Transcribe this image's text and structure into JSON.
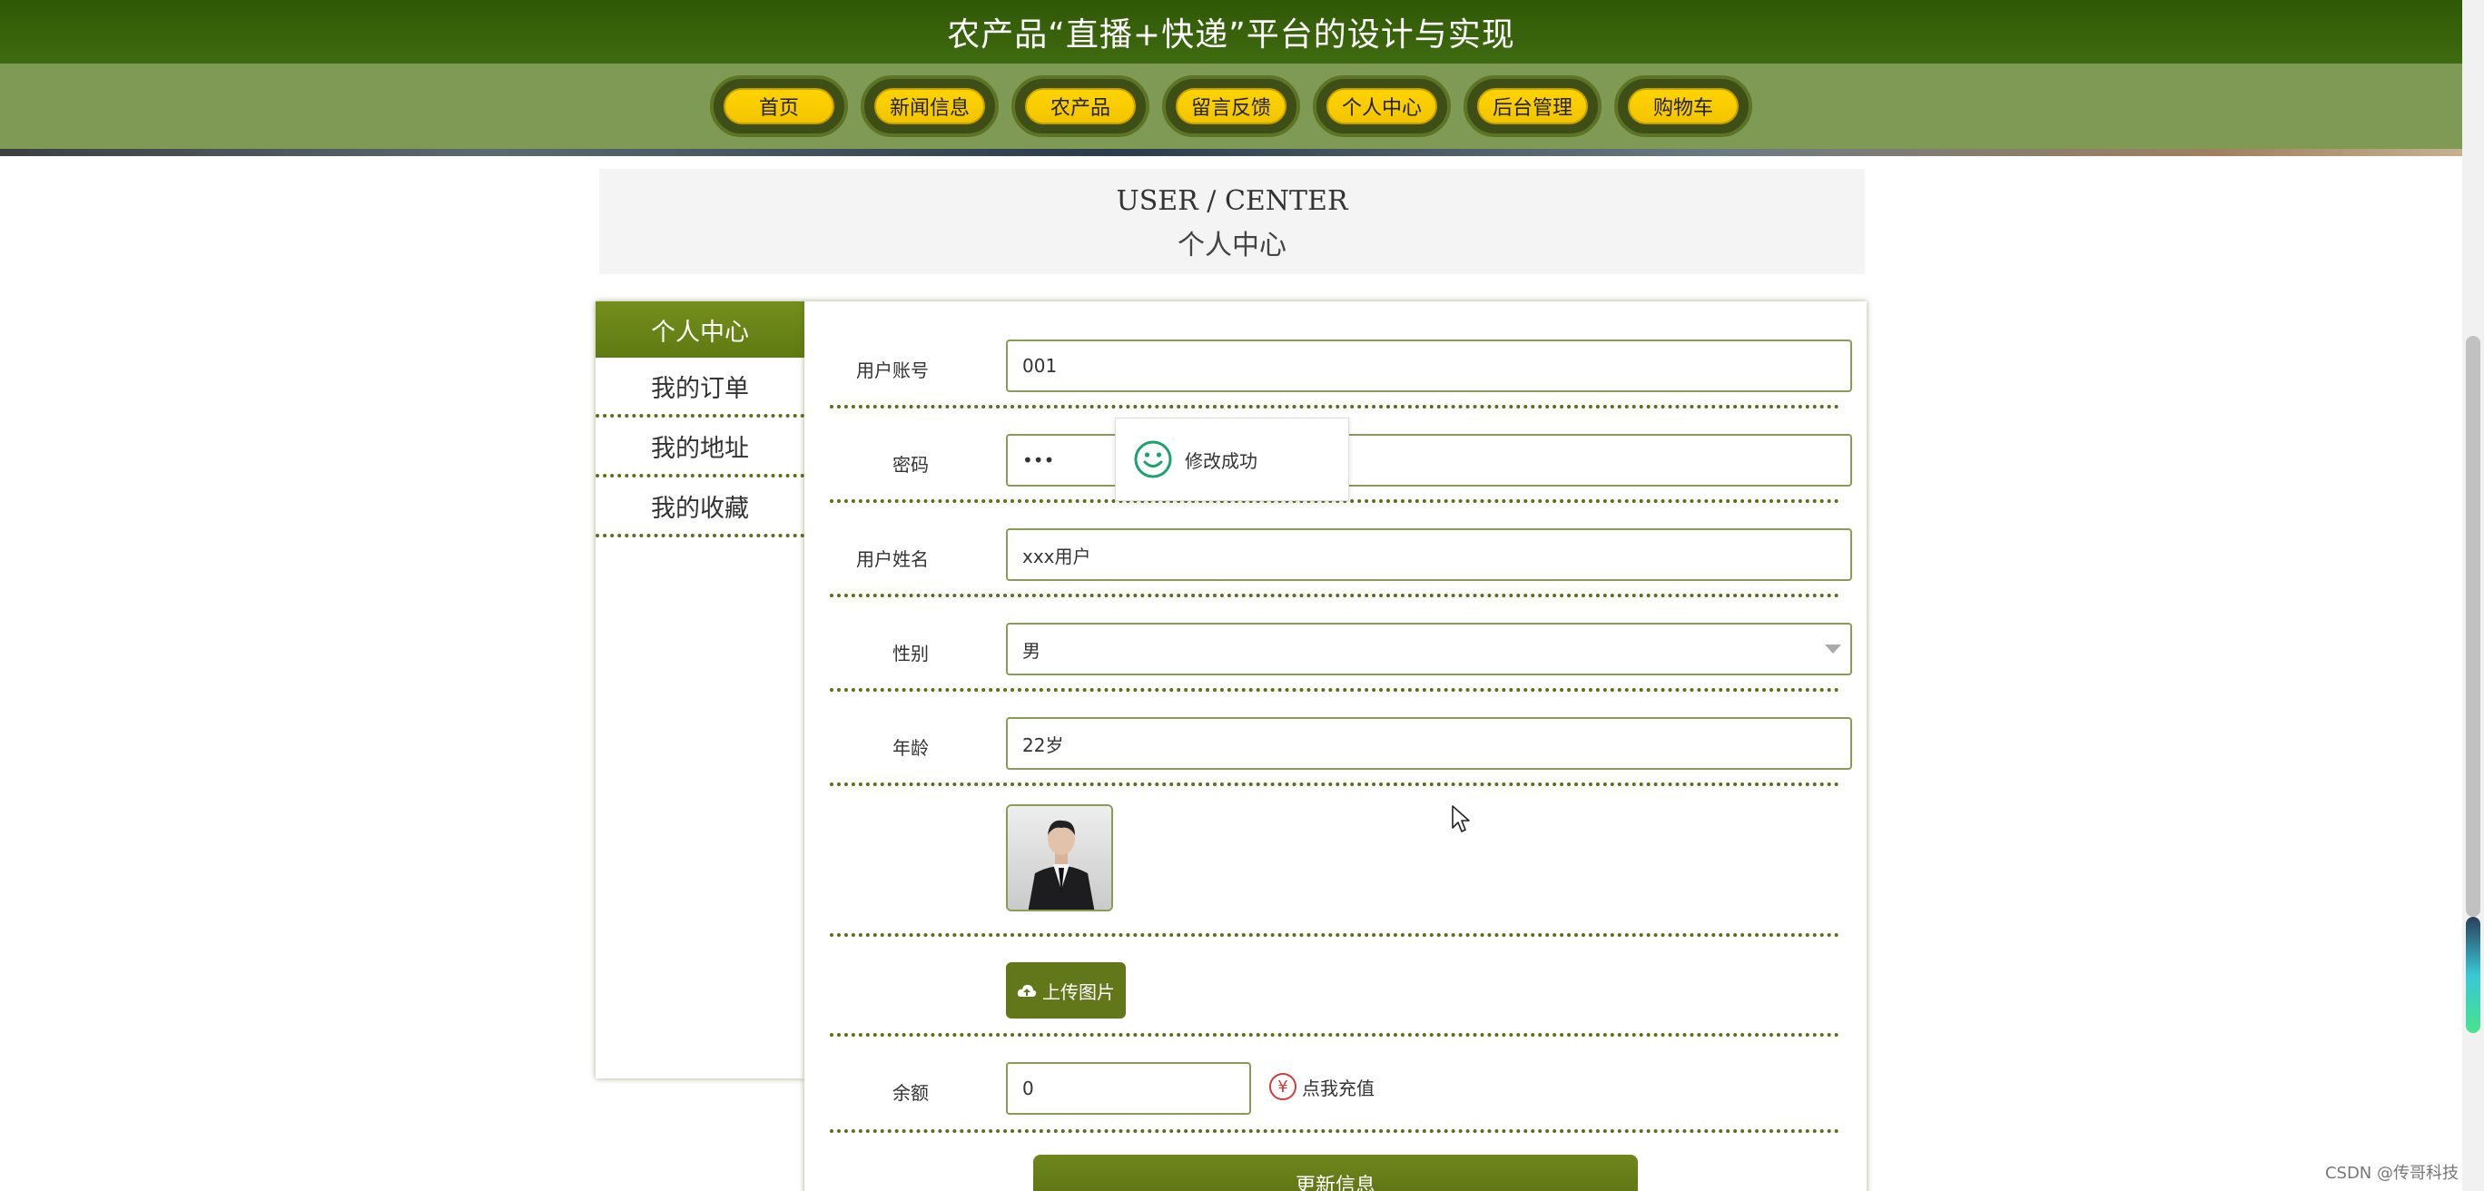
{
  "site": {
    "title": "农产品“直播+快递”平台的设计与实现"
  },
  "nav": {
    "items": [
      {
        "label": "首页",
        "name": "nav-home"
      },
      {
        "label": "新闻信息",
        "name": "nav-news"
      },
      {
        "label": "农产品",
        "name": "nav-products"
      },
      {
        "label": "留言反馈",
        "name": "nav-feedback"
      },
      {
        "label": "个人中心",
        "name": "nav-user-center"
      },
      {
        "label": "后台管理",
        "name": "nav-admin"
      },
      {
        "label": "购物车",
        "name": "nav-cart"
      }
    ]
  },
  "heading": {
    "en": "USER / CENTER",
    "cn": "个人中心"
  },
  "sidebar": {
    "items": [
      {
        "label": "个人中心",
        "active": true
      },
      {
        "label": "我的订单",
        "active": false
      },
      {
        "label": "我的地址",
        "active": false
      },
      {
        "label": "我的收藏",
        "active": false
      }
    ]
  },
  "form": {
    "account": {
      "label": "用户账号",
      "value": "001"
    },
    "password": {
      "label": "密码",
      "value": "•••"
    },
    "name": {
      "label": "用户姓名",
      "value": "xxx用户"
    },
    "gender": {
      "label": "性别",
      "value": "男"
    },
    "age": {
      "label": "年龄",
      "value": "22岁"
    },
    "upload_label": "上传图片",
    "balance": {
      "label": "余额",
      "value": "0"
    },
    "recharge_label": "点我充值",
    "yen_symbol": "¥",
    "submit_label": "更新信息"
  },
  "toast": {
    "message": "修改成功"
  },
  "watermark": "CSDN @传哥科技",
  "colors": {
    "header": "#2f5805",
    "nav": "#7f9a55",
    "accent": "#62771a",
    "pill": "#ffd400"
  },
  "icons": {
    "toast": "smile-icon",
    "upload": "cloud-upload-icon",
    "recharge": "yen-icon",
    "select": "chevron-down-icon"
  }
}
